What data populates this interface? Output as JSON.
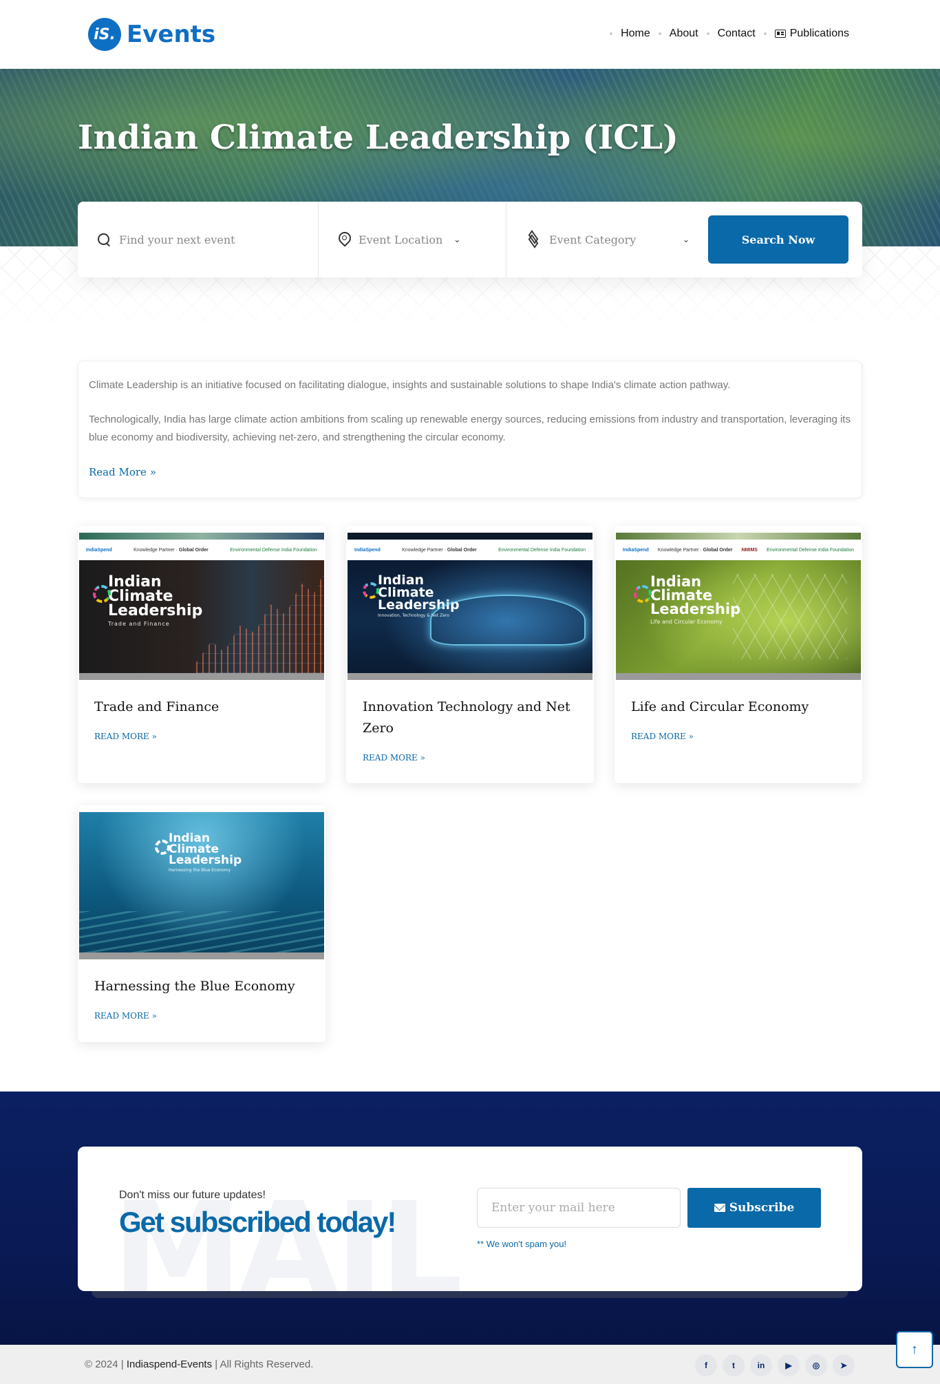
{
  "header": {
    "logo_badge": "iS.",
    "logo_text": "Events",
    "nav": [
      "Home",
      "About",
      "Contact",
      "Publications"
    ]
  },
  "hero": {
    "title": "Indian Climate Leadership (ICL)"
  },
  "search": {
    "event_placeholder": "Find your next event",
    "location_label": "Event Location",
    "category_label": "Event Category",
    "button_label": "Search Now"
  },
  "intro": {
    "paragraph1": "Climate Leadership is an initiative focused on facilitating dialogue, insights and sustainable solutions to shape India's climate action pathway.",
    "paragraph2": "Technologically, India has large climate action ambitions from scaling up renewable energy sources, reducing emissions from industry and transportation, leveraging its blue economy and biodiversity, achieving net-zero, and strengthening the circular economy.",
    "read_more": "Read More »"
  },
  "thumb_common": {
    "brand": "IndiaSpend",
    "knowledge_partner": "Knowledge Partner",
    "global_order": "Global Order",
    "edif": "Environmental Defense India Foundation",
    "nmims": "NMIMS",
    "icl_line1": "Indian",
    "icl_line2": "Climate",
    "icl_line3": "Leadership"
  },
  "events": [
    {
      "title": "Trade and Finance",
      "thumb_subtitle": "Trade and Finance",
      "more": "READ MORE »"
    },
    {
      "title": "Innovation Technology and Net Zero",
      "thumb_subtitle": "Innovation, Technology & Net Zero",
      "more": "READ MORE »"
    },
    {
      "title": "Life and Circular Economy",
      "thumb_subtitle": "Life and Circular Economy",
      "more": "READ MORE »"
    },
    {
      "title": "Harnessing the Blue Economy",
      "thumb_subtitle": "Harnessing the Blue Economy",
      "more": "READ MORE »"
    }
  ],
  "newsletter": {
    "watermark": "MAIL",
    "kicker": "Don't miss our future updates!",
    "heading": "Get subscribed today!",
    "email_placeholder": "Enter your mail here",
    "button_label": "Subscribe",
    "note": "** We won't spam you!"
  },
  "footer": {
    "copyright_prefix": "© 2024 | ",
    "brand": "Indiaspend-Events",
    "copyright_suffix": " | All Rights Reserved.",
    "social": [
      {
        "icon": "facebook-icon",
        "glyph": "f"
      },
      {
        "icon": "twitter-icon",
        "glyph": "t"
      },
      {
        "icon": "linkedin-icon",
        "glyph": "in"
      },
      {
        "icon": "youtube-icon",
        "glyph": "▶"
      },
      {
        "icon": "instagram-icon",
        "glyph": "◎"
      },
      {
        "icon": "telegram-icon",
        "glyph": "➤"
      }
    ]
  },
  "back_to_top": "↑",
  "colors": {
    "brand_blue": "#0a69a8",
    "logo_blue": "#0d6fc4",
    "footer_navy": "#0b2062"
  }
}
